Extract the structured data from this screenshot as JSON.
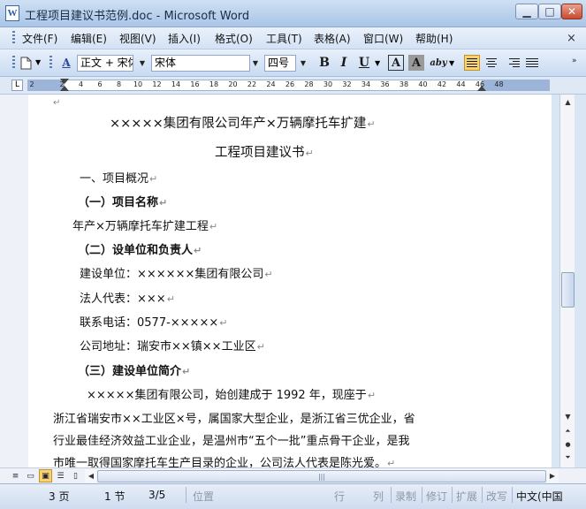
{
  "window": {
    "title": "工程项目建议书范例.doc - Microsoft Word",
    "app_icon": "W",
    "controls": {
      "minimize": "▁",
      "maximize": "□",
      "close": "✕"
    }
  },
  "menu": {
    "items": [
      "文件(F)",
      "编辑(E)",
      "视图(V)",
      "插入(I)",
      "格式(O)",
      "工具(T)",
      "表格(A)",
      "窗口(W)",
      "帮助(H)"
    ],
    "doc_menu_icon": "×"
  },
  "toolbar": {
    "style": "正文 + 宋体",
    "font": "宋体",
    "size": "四号",
    "bold": "B",
    "italic": "I",
    "underline": "U",
    "char_border": "A",
    "char_shading": "A",
    "highlight": "aby",
    "style_pane_icon": "A",
    "dropdown_glyph": "▼"
  },
  "ruler": {
    "tab_selector": "L",
    "ticks": [
      "2",
      "2",
      "4",
      "6",
      "8",
      "10",
      "12",
      "14",
      "16",
      "18",
      "20",
      "22",
      "24",
      "26",
      "28",
      "30",
      "32",
      "34",
      "36",
      "38",
      "40",
      "42",
      "44",
      "46",
      "48"
    ]
  },
  "document": {
    "paragraph_mark": "↵",
    "lines": [
      "×××××集团有限公司年产×万辆摩托车扩建",
      "工程项目建议书",
      "一、项目概况",
      "（一）项目名称",
      "年产×万辆摩托车扩建工程",
      "（二）设单位和负责人",
      "建设单位：××××××集团有限公司",
      "法人代表：×××",
      "联系电话：0577-×××××",
      "公司地址：瑞安市××镇××工业区",
      "（三）建设单位简介",
      "×××××集团有限公司，始创建成于 1992 年，现座于",
      "浙江省瑞安市××工业区×号，属国家大型企业，是浙江省三优企业，省",
      "行业最佳经济效益工业企业，是温州市“五个一批”重点骨干企业，是我",
      "市唯一取得国家摩托车生产目录的企业，公司法人代表是陈光爱。"
    ]
  },
  "scrollbar": {
    "up": "▲",
    "down": "▼",
    "prev_page": "⏶",
    "browse_object": "●",
    "next_page": "⏷",
    "left": "◀",
    "right": "▶",
    "thumb_grip": "|||"
  },
  "status": {
    "page": "3 页",
    "section": "1 节",
    "page_of": "3/5",
    "position": "位置",
    "line": "行",
    "column": "列",
    "rec": "录制",
    "trk": "修订",
    "ext": "扩展",
    "ovr": "改写",
    "language": "中文(中国"
  }
}
